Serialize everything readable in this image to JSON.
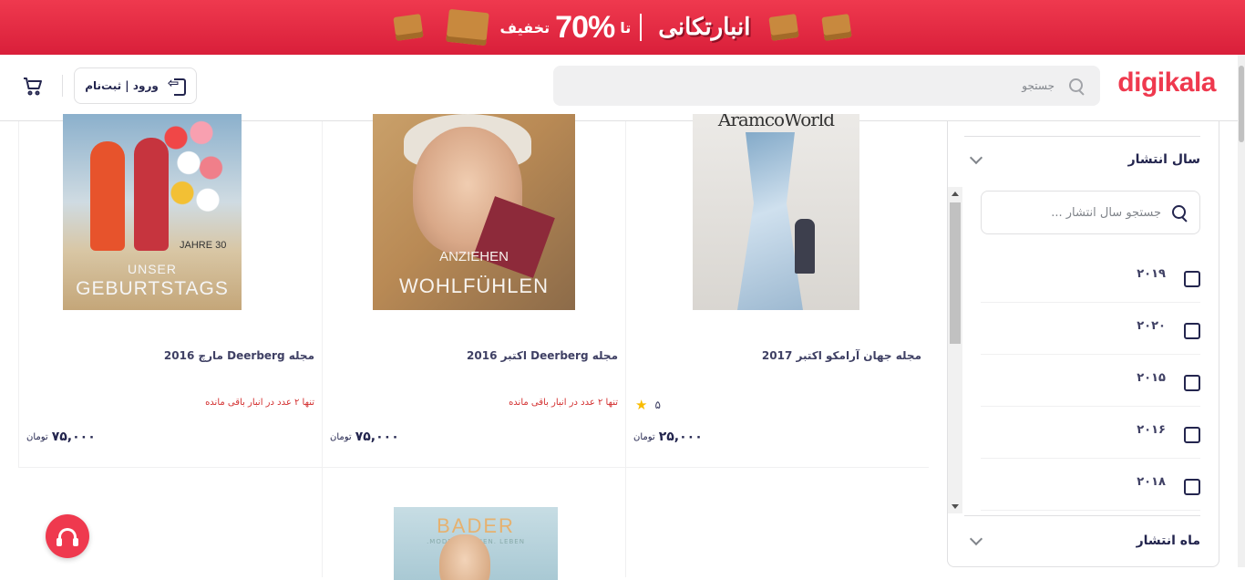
{
  "banner": {
    "brand_text": "انبارتکانی",
    "upto": "تا",
    "percent": "70%",
    "discount": "تخفیف"
  },
  "header": {
    "logo": "digikala",
    "search_placeholder": "جستجو",
    "login_label": "ورود | ثبت‌نام"
  },
  "products": [
    {
      "title": "مجله جهان آرامکو اکتبر 2017",
      "rating": "۵",
      "price": "۲۵,۰۰۰",
      "currency": "تومان",
      "image": {
        "masthead": "AramcoWorld"
      }
    },
    {
      "title": "مجله Deerberg اکتبر 2016",
      "stock": "تنها ۲ عدد در انبار باقی مانده",
      "price": "۷۵,۰۰۰",
      "currency": "تومان",
      "image": {
        "line1": "ANZIEHEN",
        "line2": "WOHLFÜHLEN"
      }
    },
    {
      "title": "مجله Deerberg مارچ 2016",
      "stock": "تنها ۲ عدد در انبار باقی مانده",
      "price": "۷۵,۰۰۰",
      "currency": "تومان",
      "image": {
        "line1": "UNSER",
        "line2": "GEBURTSTAGS",
        "line3": "30 JAHRE"
      }
    }
  ],
  "row2_image": {
    "brand": "BADER",
    "tagline": "MODE. WOHNEN. LEBEN."
  },
  "filter": {
    "year_title": "سال انتشار",
    "year_search_placeholder": "جستجو سال انتشار ...",
    "years": [
      "۲۰۱۹",
      "۲۰۲۰",
      "۲۰۱۵",
      "۲۰۱۶",
      "۲۰۱۸"
    ],
    "month_title": "ماه انتشار"
  },
  "colors": {
    "brand": "#ef394e",
    "text": "#23254e",
    "star": "#f9bc00",
    "stock_warning": "#d32f2f"
  }
}
